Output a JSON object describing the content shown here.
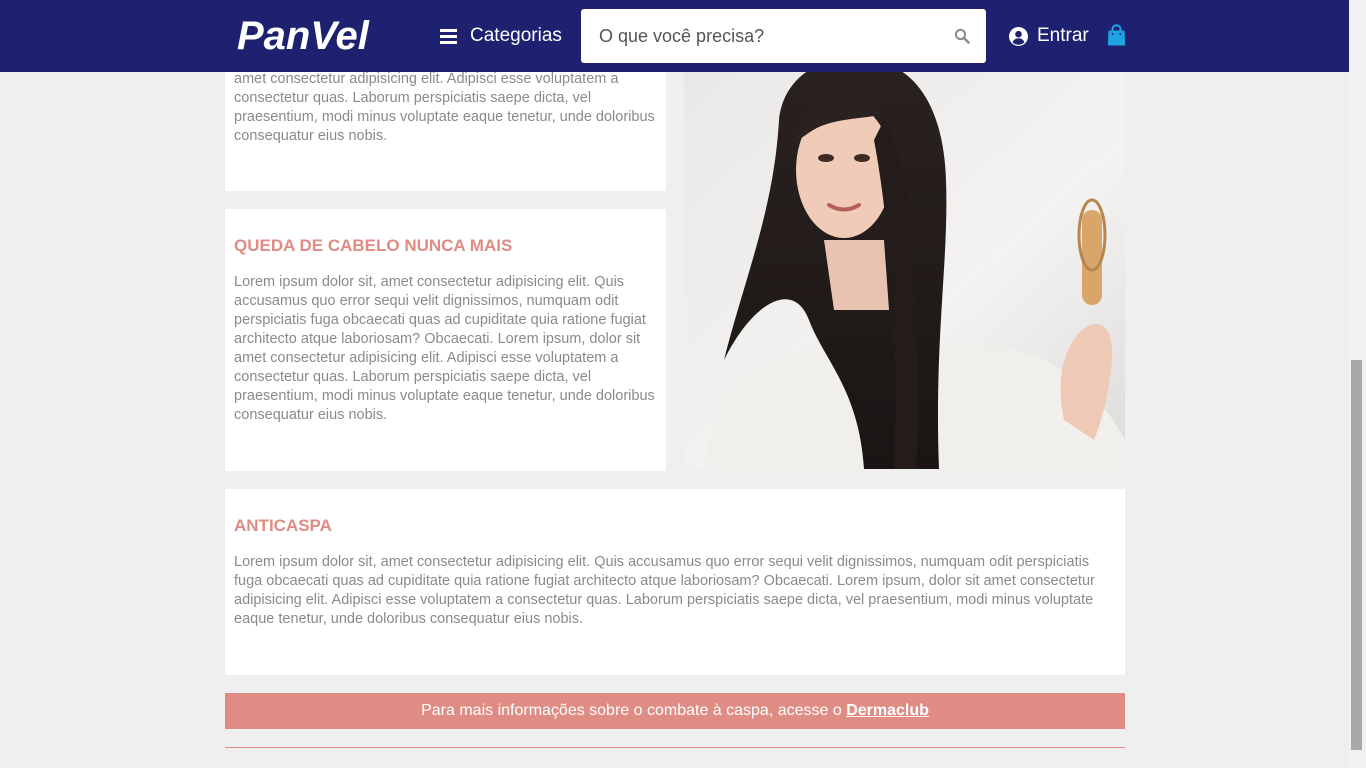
{
  "header": {
    "logo_text": "PanVel",
    "categories_label": "Categorias",
    "search_placeholder": "O que você precisa?",
    "login_label": "Entrar"
  },
  "cards": [
    {
      "title": "",
      "text": "amet consectetur adipisicing elit. Adipisci esse voluptatem a consectetur quas. Laborum perspiciatis saepe dicta, vel praesentium, modi minus voluptate eaque tenetur, unde doloribus consequatur eius nobis."
    },
    {
      "title": "QUEDA DE CABELO NUNCA MAIS",
      "text": "Lorem ipsum dolor sit, amet consectetur adipisicing elit. Quis accusamus quo error sequi velit dignissimos, numquam odit perspiciatis fuga obcaecati quas ad cupiditate quia ratione fugiat architecto atque laboriosam? Obcaecati. Lorem ipsum, dolor sit amet consectetur adipisicing elit. Adipisci esse voluptatem a consectetur quas. Laborum perspiciatis saepe dicta, vel praesentium, modi minus voluptate eaque tenetur, unde doloribus consequatur eius nobis."
    },
    {
      "title": "ANTICASPA",
      "text": "Lorem ipsum dolor sit, amet consectetur adipisicing elit. Quis accusamus quo error sequi velit dignissimos, numquam odit perspiciatis fuga obcaecati quas ad cupiditate quia ratione fugiat architecto atque laboriosam? Obcaecati. Lorem ipsum, dolor sit amet consectetur adipisicing elit. Adipisci esse voluptatem a consectetur quas. Laborum perspiciatis saepe dicta, vel praesentium, modi minus voluptate eaque tenetur, unde doloribus consequatur eius nobis."
    }
  ],
  "info_bar": {
    "text": "Para mais informações sobre o combate à caspa, acesse o ",
    "link_label": "Dermaclub"
  },
  "colors": {
    "header_bg": "#1e2170",
    "accent": "#df8c84",
    "bag_icon": "#1ea3e0"
  },
  "icons": {
    "menu": "hamburger-icon",
    "search": "magnifier-icon",
    "user": "user-circle-icon",
    "bag": "shopping-bag-icon"
  }
}
